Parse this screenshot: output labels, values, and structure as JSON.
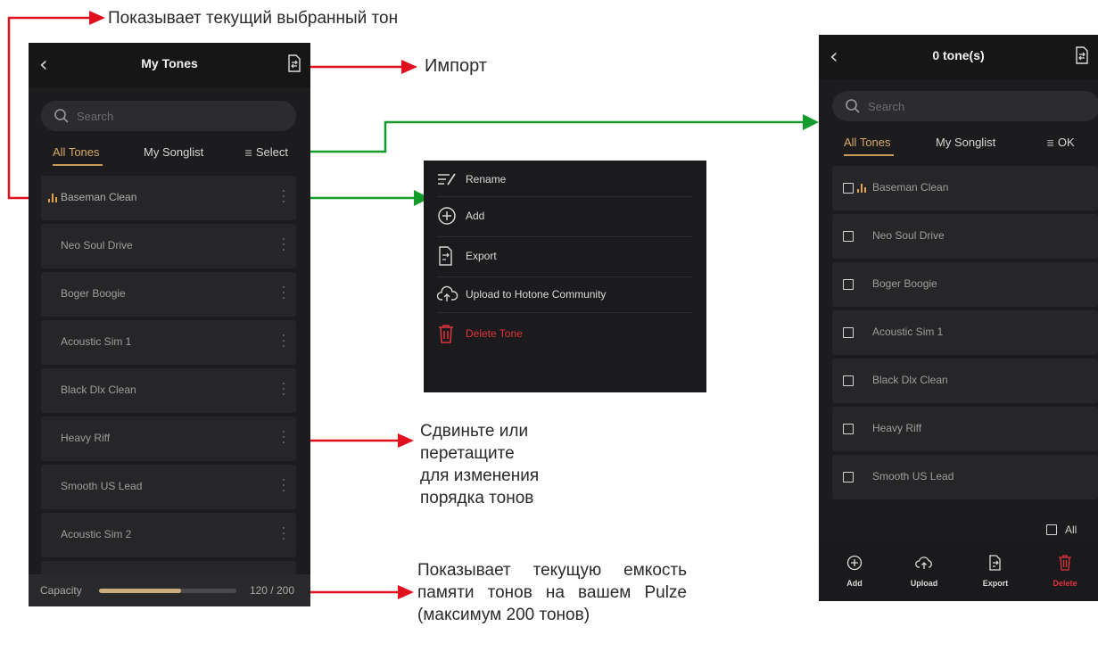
{
  "annotations": {
    "current_tone": "Показывает текущий выбранный тон",
    "import": "Импорт",
    "reorder": [
      "Сдвиньте или",
      "перетащите",
      "для изменения",
      "порядка тонов"
    ],
    "capacity": "Показывает текущую емкость памяти тонов на вашем Pulze (максимум 200 тонов)"
  },
  "left_panel": {
    "title": "My Tones",
    "search_placeholder": "Search",
    "tabs": [
      "All Tones",
      "My Songlist"
    ],
    "select_label": "Select",
    "tones": [
      "Baseman Clean",
      "Neo Soul Drive",
      "Boger Boogie",
      "Acoustic Sim 1",
      "Black Dlx Clean",
      "Heavy Riff",
      "Smooth US Lead",
      "Acoustic Sim 2"
    ],
    "capacity_label": "Capacity",
    "capacity_value": "120 / 200",
    "capacity_fraction": 0.6
  },
  "menu": {
    "items": [
      {
        "label": "Rename",
        "icon": "rename-icon"
      },
      {
        "label": "Add",
        "icon": "plus-circle-icon"
      },
      {
        "label": "Export",
        "icon": "export-icon"
      },
      {
        "label": "Upload to Hotone Community",
        "icon": "cloud-upload-icon"
      },
      {
        "label": "Delete Tone",
        "icon": "trash-icon"
      }
    ]
  },
  "right_panel": {
    "title": "0 tone(s)",
    "search_placeholder": "Search",
    "tabs": [
      "All Tones",
      "My Songlist"
    ],
    "ok_label": "OK",
    "tones": [
      "Baseman Clean",
      "Neo Soul Drive",
      "Boger Boogie",
      "Acoustic Sim 1",
      "Black Dlx Clean",
      "Heavy Riff",
      "Smooth US Lead"
    ],
    "all_label": "All",
    "toolbar": [
      "Add",
      "Upload",
      "Export",
      "Delete"
    ]
  },
  "colors": {
    "accent": "#d7a868",
    "arrow_red": "#e0101e",
    "arrow_green": "#159a2c",
    "delete_red": "#e0333b"
  }
}
